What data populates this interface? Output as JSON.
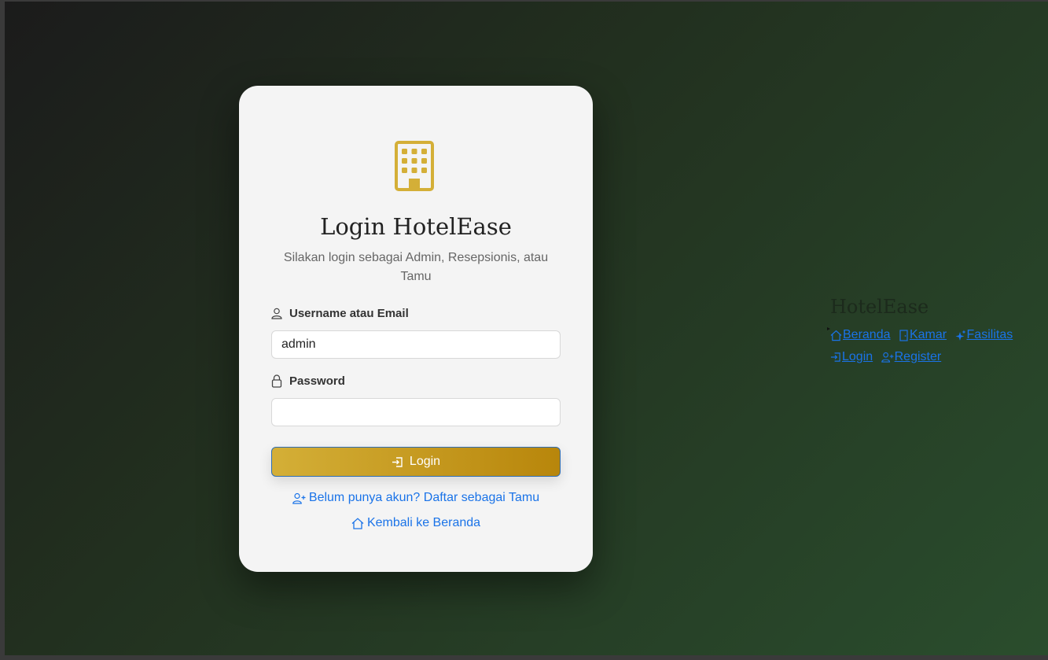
{
  "colors": {
    "gold": "#d4af37",
    "gold_dark": "#b8860b",
    "link": "#1a73e8"
  },
  "card": {
    "logo_icon": "building-icon",
    "title": "Login HotelEase",
    "subtitle": "Silakan login sebagai Admin, Resepsionis, atau Tamu",
    "username": {
      "label": "Username atau Email",
      "value": "admin",
      "icon": "person-icon"
    },
    "password": {
      "label": "Password",
      "value": "",
      "icon": "lock-icon"
    },
    "login_button": {
      "label": "Login",
      "icon": "box-arrow-in-icon"
    },
    "register_link": {
      "label": "Belum punya akun? Daftar sebagai Tamu",
      "icon": "person-plus-icon"
    },
    "home_link": {
      "label": "Kembali ke Beranda",
      "icon": "house-icon"
    }
  },
  "navbar": {
    "brand": "HotelEase",
    "items": [
      {
        "label": "Beranda",
        "icon": "house-icon"
      },
      {
        "label": "Kamar",
        "icon": "door-icon"
      },
      {
        "label": "Fasilitas",
        "icon": "stars-icon"
      },
      {
        "label": "Login",
        "icon": "box-arrow-in-icon"
      },
      {
        "label": "Register",
        "icon": "person-plus-icon"
      }
    ]
  }
}
